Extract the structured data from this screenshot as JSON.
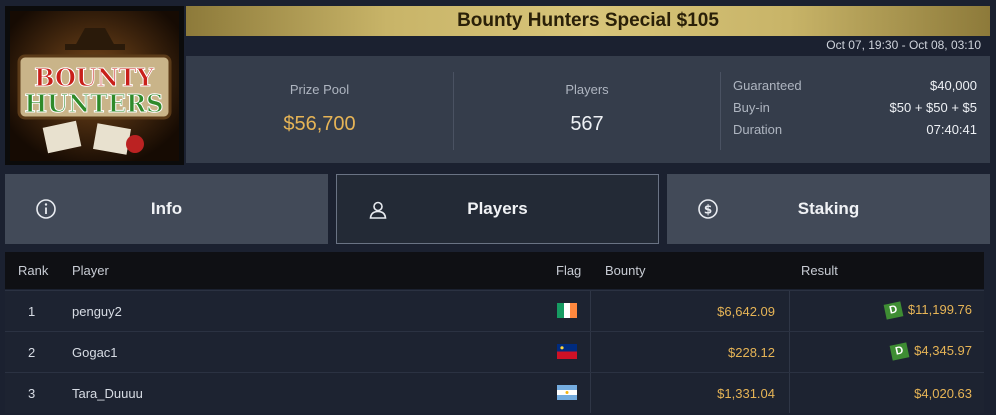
{
  "tournament": {
    "title": "Bounty Hunters Special $105",
    "dates": "Oct 07, 19:30 - Oct 08, 03:10",
    "logo_text_top": "BOUNTY",
    "logo_text_bottom": "HUNTERS"
  },
  "stats": {
    "prize_pool_label": "Prize Pool",
    "prize_pool_value": "$56,700",
    "players_label": "Players",
    "players_value": "567",
    "guaranteed_label": "Guaranteed",
    "guaranteed_value": "$40,000",
    "buyin_label": "Buy-in",
    "buyin_value": "$50 + $50 + $5",
    "duration_label": "Duration",
    "duration_value": "07:40:41"
  },
  "tabs": {
    "info": "Info",
    "players": "Players",
    "staking": "Staking"
  },
  "table": {
    "headers": {
      "rank": "Rank",
      "player": "Player",
      "flag": "Flag",
      "bounty": "Bounty",
      "result": "Result"
    },
    "rows": [
      {
        "rank": "1",
        "player": "penguy2",
        "flag": "ireland",
        "bounty": "$6,642.09",
        "result": "$11,199.76",
        "badge": "D"
      },
      {
        "rank": "2",
        "player": "Gogac1",
        "flag": "liechtenstein",
        "bounty": "$228.12",
        "result": "$4,345.97",
        "badge": "D"
      },
      {
        "rank": "3",
        "player": "Tara_Duuuu",
        "flag": "argentina",
        "bounty": "$1,331.04",
        "result": "$4,020.63",
        "badge": ""
      }
    ]
  },
  "colors": {
    "gold": "#e6b456",
    "banner": "#d8c57a",
    "badge_green": "#3e8d33"
  }
}
